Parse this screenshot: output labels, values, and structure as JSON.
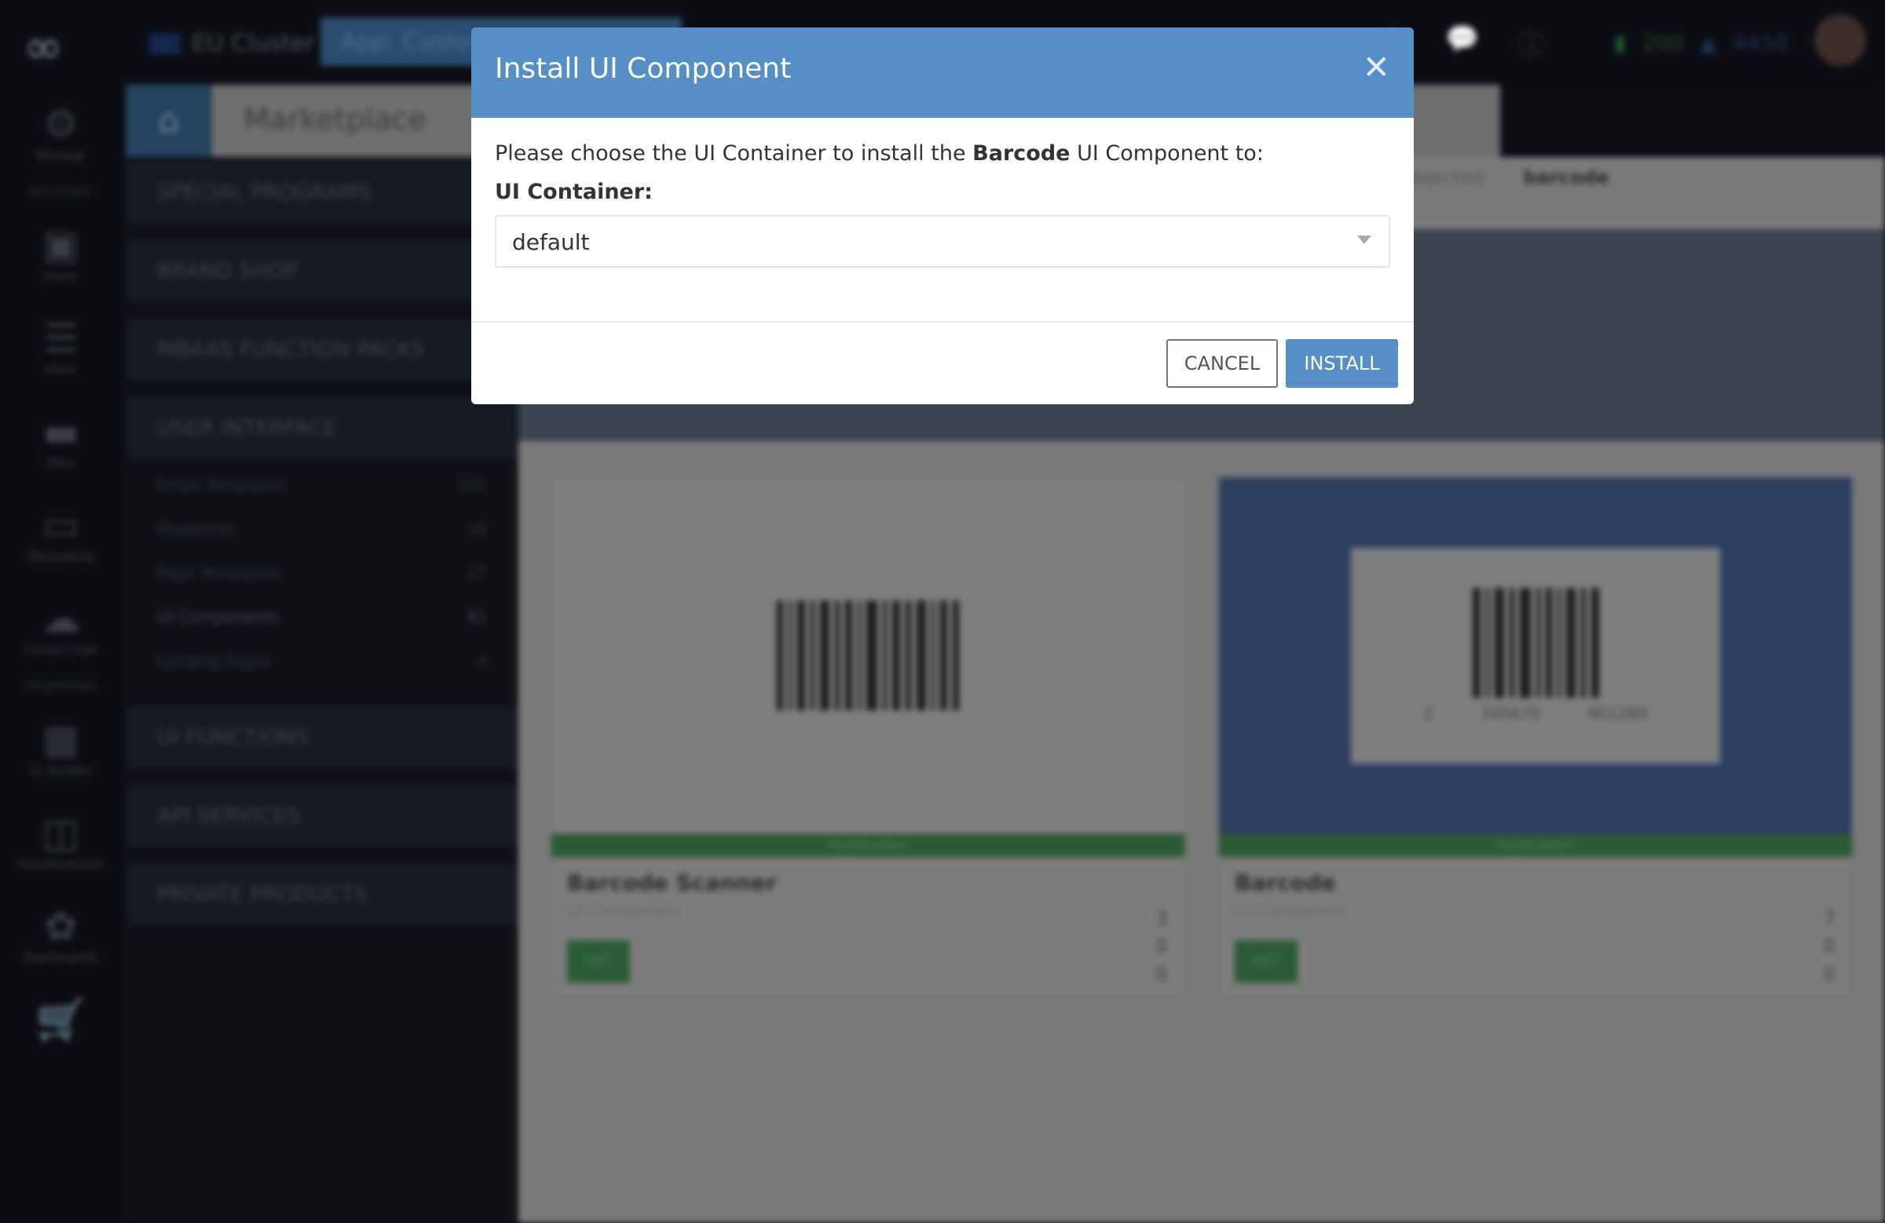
{
  "topbar": {
    "cluster": "EU Cluster",
    "app_tab": "App: Customer",
    "credits_green": "200",
    "credits_blue": "4450"
  },
  "icon_sidebar": {
    "items": [
      {
        "label": "Manage",
        "icon": "gear-icon"
      },
      {
        "section": "BACKEND"
      },
      {
        "label": "Users",
        "icon": "users-icon"
      },
      {
        "label": "Data",
        "icon": "database-icon"
      },
      {
        "label": "Files",
        "icon": "folder-icon"
      },
      {
        "label": "Messaging",
        "icon": "sms-icon"
      },
      {
        "label": "Cloud Code",
        "icon": "cloud-icon"
      },
      {
        "section": "FRONTEND"
      },
      {
        "label": "UI Builder",
        "icon": "layout-icon"
      },
      {
        "label": "Visualizations",
        "icon": "charts-icon"
      },
      {
        "label": "Dashboards",
        "icon": "dashboard-icon"
      }
    ]
  },
  "marketplace": {
    "title": "Marketplace",
    "categories": [
      "SPECIAL PROGRAMS",
      "BRAND SHOP",
      "MBAAS FUNCTION PACKS",
      "USER INTERFACE",
      "UI FUNCTIONS",
      "API SERVICES",
      "PRIVATE PRODUCTS"
    ],
    "subitems": [
      {
        "label": "Email Templates",
        "count": "101"
      },
      {
        "label": "Blueprints",
        "count": "18"
      },
      {
        "label": "Page Templates",
        "count": "27"
      },
      {
        "label": "UI Components",
        "count": "91"
      },
      {
        "label": "Landing Pages",
        "count": "4"
      }
    ],
    "filter_label": "Rejected",
    "search_value": "barcode",
    "cards": [
      {
        "title": "Barcode Scanner",
        "subtitle": "UI Component",
        "band": "Application",
        "get": "GET",
        "stats": [
          "3",
          "0",
          "0"
        ]
      },
      {
        "title": "Barcode",
        "subtitle": "UI Component",
        "band": "Application",
        "get": "GET",
        "stats": [
          "7",
          "0",
          "0"
        ],
        "barcode_digits": [
          "2",
          "345678",
          "901289"
        ]
      }
    ]
  },
  "modal": {
    "title": "Install UI Component",
    "message_before": "Please choose the UI Container to install the ",
    "message_bold": "Barcode",
    "message_after": " UI Component to:",
    "label": "UI Container:",
    "select_value": "default",
    "cancel": "CANCEL",
    "install": "INSTALL",
    "accent": "#558fc5"
  }
}
